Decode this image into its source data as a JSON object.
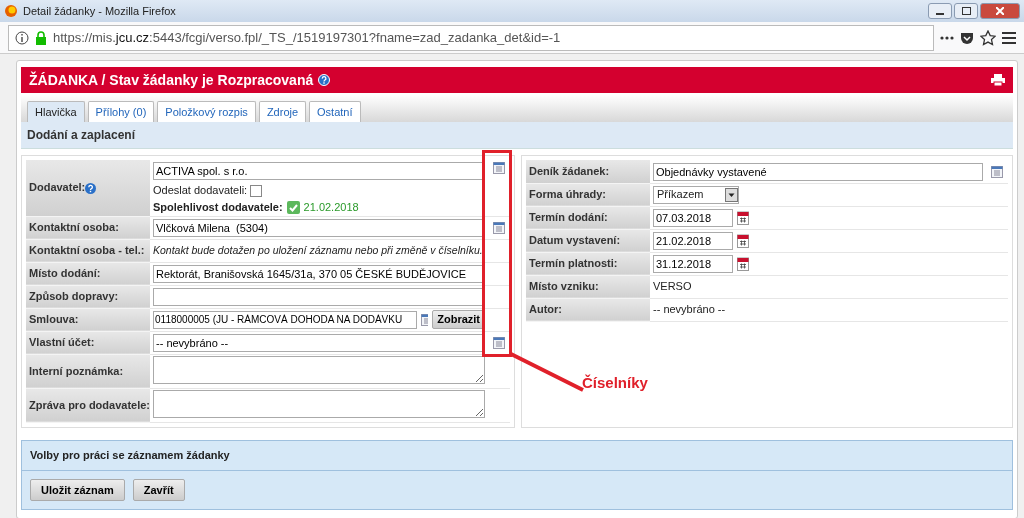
{
  "window": {
    "title": "Detail žádanky - Mozilla Firefox"
  },
  "address_bar": {
    "url": "https://mis.**jcu.cz**:5443/fcgi/verso.fpl/_TS_/1519197301?fname=zad_zadanka_det&id=-1"
  },
  "header": {
    "title": "ŽÁDANKA / Stav žádanky je Rozpracovaná"
  },
  "tabs": [
    {
      "label": "Hlavička",
      "selected": true
    },
    {
      "label": "Přílohy (0)",
      "selected": false
    },
    {
      "label": "Položkový rozpis",
      "selected": false
    },
    {
      "label": "Zdroje",
      "selected": false
    },
    {
      "label": "Ostatní",
      "selected": false
    }
  ],
  "section": {
    "title": "Dodání a zaplacení"
  },
  "left_fields": [
    {
      "kind": "supplier",
      "label": "Dodavatel:",
      "value": "ACTIVA spol. s r.o.",
      "send_label": "Odeslat dodavateli:",
      "send_checked": false,
      "reliability_label": "Spolehlivost dodavatele:",
      "reliability_date": "21.02.2018"
    },
    {
      "kind": "lookup",
      "label": "Kontaktní osoba:",
      "value": "Vlčková Milena  (5304)"
    },
    {
      "kind": "note",
      "label": "Kontaktní osoba - tel.:",
      "value": "Kontakt bude dotažen po uložení záznamu nebo při změně v číselníku."
    },
    {
      "kind": "input",
      "label": "Místo dodání:",
      "value": "Rektorát, Branišovská 1645/31a, 370 05 ČESKÉ BUDĚJOVICE"
    },
    {
      "kind": "input",
      "label": "Způsob dopravy:"
    },
    {
      "kind": "contract",
      "label": "Smlouva:",
      "value": "0118000005 (JU - RÁMCOVÁ DOHODA NA DODÁVKU",
      "button": "Zobrazit"
    },
    {
      "kind": "lookup",
      "label": "Vlastní účet:",
      "value": "-- nevybráno --"
    },
    {
      "kind": "textarea",
      "label": "Interní poznámka:"
    },
    {
      "kind": "textarea",
      "label": "Zpráva pro dodavatele:"
    }
  ],
  "right_fields": [
    {
      "kind": "lookup",
      "label": "Deník žádanek:",
      "value": "Objednávky vystavené"
    },
    {
      "kind": "select",
      "label": "Forma úhrady:",
      "value": "Příkazem"
    },
    {
      "kind": "date",
      "label": "Termín dodání:",
      "value": "07.03.2018"
    },
    {
      "kind": "date",
      "label": "Datum vystavení:",
      "value": "21.02.2018"
    },
    {
      "kind": "date",
      "label": "Termín platnosti:",
      "value": "31.12.2018"
    },
    {
      "kind": "text",
      "label": "Místo vzniku:",
      "value": "VERSO"
    },
    {
      "kind": "text",
      "label": "Autor:",
      "value": "-- nevybráno --"
    }
  ],
  "actions": {
    "title": "Volby pro práci se záznamem žádanky",
    "buttons": [
      "Uložit záznam",
      "Zavřít"
    ]
  },
  "annotation": {
    "label": "Číselníky"
  }
}
